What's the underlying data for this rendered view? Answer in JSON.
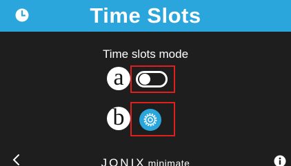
{
  "header": {
    "title": "Time Slots",
    "clock_icon": "clock-icon",
    "color": "#2aa6dc"
  },
  "main": {
    "mode_label": "Time slots mode",
    "toggle": {
      "state": "off",
      "icon": "toggle-switch"
    },
    "settings_button": {
      "icon": "gear-icon",
      "color": "#2aa6dc"
    },
    "annotations": [
      {
        "letter": "a"
      },
      {
        "letter": "b"
      }
    ],
    "annotation_color": "#e0201c"
  },
  "footer": {
    "back_icon": "chevron-left-icon",
    "brand_name": "JONIX",
    "brand_sub": "minimate",
    "info_icon": "info-icon"
  }
}
